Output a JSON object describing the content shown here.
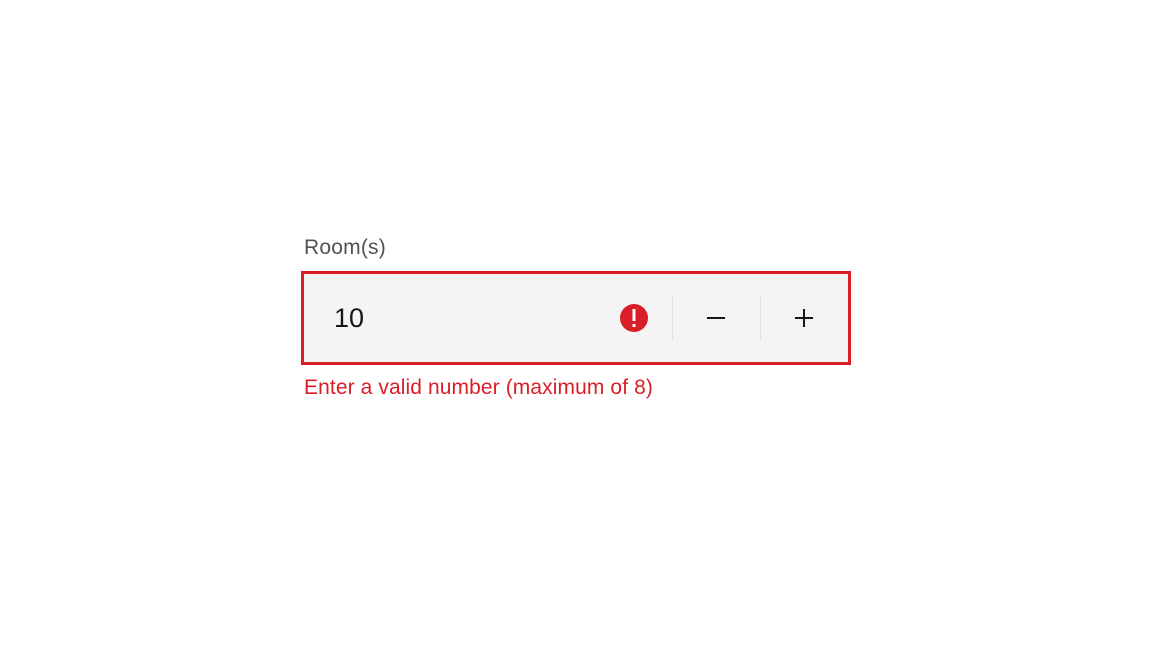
{
  "stepper": {
    "label": "Room(s)",
    "value": "10",
    "error_message": "Enter a valid number (maximum of 8)"
  }
}
